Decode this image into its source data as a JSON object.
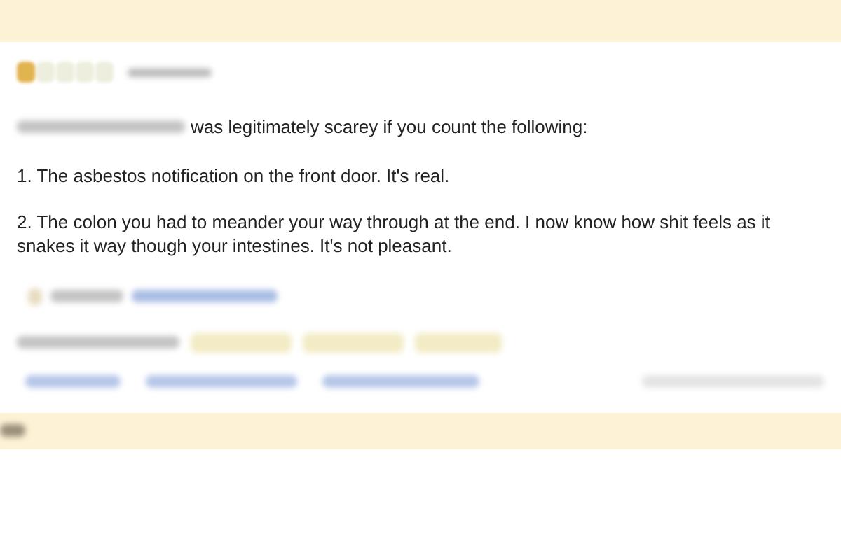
{
  "rating": {
    "stars": 1
  },
  "review": {
    "intro": "was legitimately scarey if you count the following:",
    "points": [
      "1. The asbestos notification on the front door. It's real.",
      "2. The colon you had to meander your way through at the end. I now know how shit feels as it snakes it way though your intestines. It's not pleasant."
    ]
  }
}
